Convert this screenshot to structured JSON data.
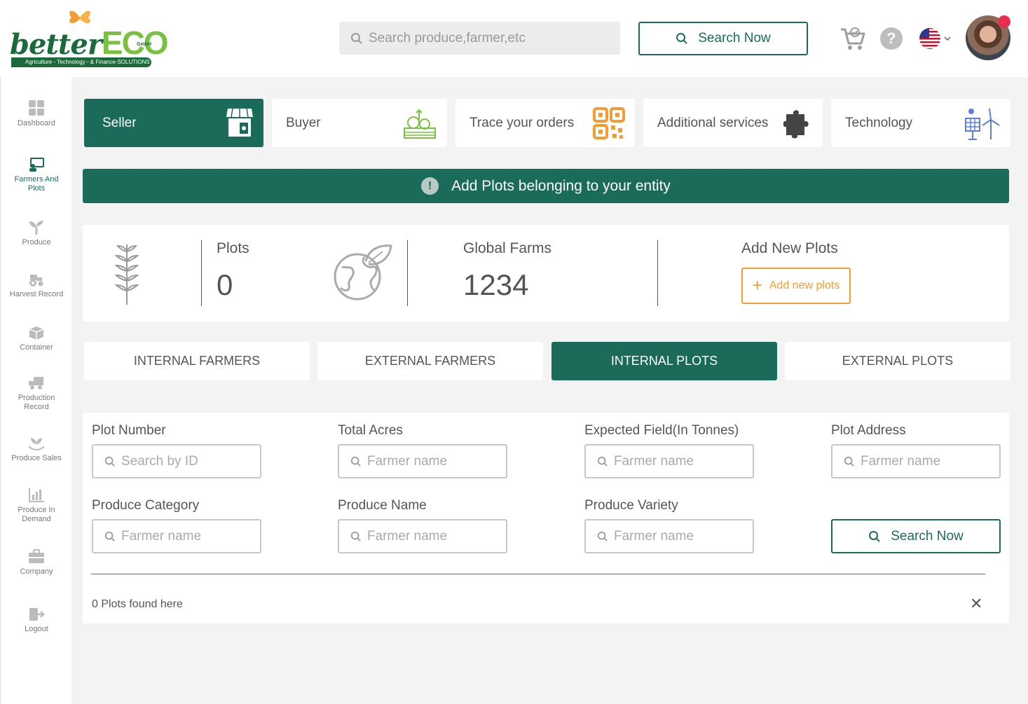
{
  "brand": {
    "name_part1": "better",
    "name_part2": "ECO",
    "suffix": "GmbH",
    "tagline": "Agriculture - Technology - & Finance-SOLUTIONS"
  },
  "header": {
    "search_placeholder": "Search produce,farmer,etc",
    "search_button": "Search Now",
    "help_glyph": "?",
    "language_flag": "us-flag-icon"
  },
  "sidebar": {
    "items": [
      {
        "label": "Dashboard",
        "icon": "grid-icon"
      },
      {
        "label": "Farmers And Plots",
        "icon": "farmer-icon",
        "active": true
      },
      {
        "label": "Produce",
        "icon": "sprout-icon"
      },
      {
        "label": "Harvest Record",
        "icon": "tractor-icon"
      },
      {
        "label": "Container",
        "icon": "box-icon"
      },
      {
        "label": "Production Record",
        "icon": "truck-icon"
      },
      {
        "label": "Produce Sales",
        "icon": "hand-plant-icon"
      },
      {
        "label": "Produce In Demand",
        "icon": "bar-chart-icon"
      },
      {
        "label": "Company",
        "icon": "briefcase-icon"
      },
      {
        "label": "Logout",
        "icon": "logout-icon"
      }
    ]
  },
  "categories": [
    {
      "label": "Seller",
      "icon": "shop-icon",
      "active": true
    },
    {
      "label": "Buyer",
      "icon": "vegetable-basket-icon"
    },
    {
      "label": "Trace your orders",
      "icon": "qr-code-icon"
    },
    {
      "label": "Additional services",
      "icon": "puzzle-icon"
    },
    {
      "label": "Technology",
      "icon": "solar-wind-icon"
    }
  ],
  "banner": {
    "glyph": "!",
    "text": "Add Plots belonging to your entity"
  },
  "stats": {
    "plots_label": "Plots",
    "plots_value": "0",
    "global_label": "Global Farms",
    "global_value": "1234",
    "add_label": "Add New Plots",
    "add_button": "Add new plots"
  },
  "tabs": [
    {
      "label": "INTERNAL FARMERS"
    },
    {
      "label": "EXTERNAL FARMERS"
    },
    {
      "label": "INTERNAL PLOTS",
      "active": true
    },
    {
      "label": "EXTERNAL PLOTS"
    }
  ],
  "filters": {
    "plot_number": {
      "label": "Plot Number",
      "placeholder": "Search by ID"
    },
    "total_acres": {
      "label": "Total Acres",
      "placeholder": "Farmer name"
    },
    "expected_field": {
      "label": "Expected Field(In Tonnes)",
      "placeholder": "Farmer name"
    },
    "plot_address": {
      "label": "Plot Address",
      "placeholder": "Farmer name"
    },
    "produce_category": {
      "label": "Produce Category",
      "placeholder": "Farmer name"
    },
    "produce_name": {
      "label": "Produce Name",
      "placeholder": "Farmer name"
    },
    "produce_variety": {
      "label": "Produce Variety",
      "placeholder": "Farmer name"
    },
    "search_button": "Search Now"
  },
  "results": {
    "found_text": "0 Plots found here",
    "close_glyph": "✕"
  },
  "colors": {
    "primary": "#1b6b5a",
    "accent": "#f39c33",
    "brand_green": "#7ac142"
  }
}
